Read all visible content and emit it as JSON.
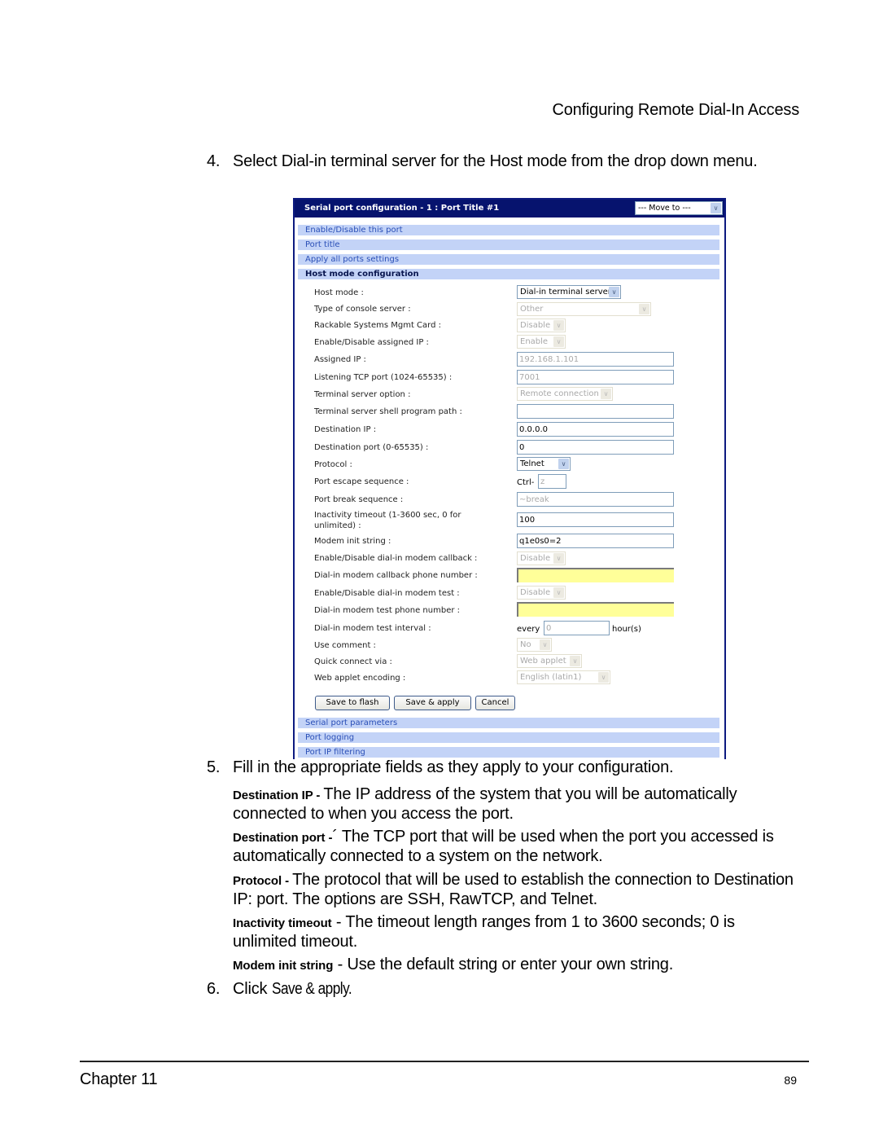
{
  "running_head": "Configuring Remote Dial-In Access",
  "steps": {
    "s4": {
      "num": "4.",
      "text": "Select Dial-in terminal server for the Host mode from the drop down menu."
    },
    "s5": {
      "num": "5.",
      "text": "Fill in the appropriate fields as they apply to your configuration."
    },
    "s6": {
      "num": "6.",
      "prefix": "Click ",
      "command": "Save & apply."
    }
  },
  "descriptions": [
    {
      "term": "Destination IP - ",
      "text": "The IP address of the system that you will be automatically connected to when you access the port."
    },
    {
      "term": "Destination port -",
      "text": "´ The TCP port that will be used when the port you accessed is automatically connected to a system on the network."
    },
    {
      "term": "Protocol - ",
      "text": "The protocol that will be used to establish the connection to Destination IP: port. The options are SSH, RawTCP, and Telnet."
    },
    {
      "term": "Inactivity timeout",
      "text": " - The timeout length ranges from 1 to 3600 seconds; 0 is unlimited timeout."
    },
    {
      "term": "Modem init string",
      "text": " - Use the default string or enter your own string."
    }
  ],
  "screenshot": {
    "title": "Serial port configuration - 1 : Port Title #1",
    "move_to": "--- Move to ---",
    "top_nav": [
      "Enable/Disable this port",
      "Port title",
      "Apply all ports settings",
      "Host mode configuration"
    ],
    "bottom_nav": [
      "Serial port parameters",
      "Port logging",
      "Port IP filtering"
    ],
    "fields": {
      "host_mode": {
        "label": "Host mode :",
        "value": "Dial-in terminal server"
      },
      "console_type": {
        "label": "Type of console server :",
        "value": "Other"
      },
      "rackable": {
        "label": "Rackable Systems Mgmt Card :",
        "value": "Disable"
      },
      "assigned_ip_enable": {
        "label": "Enable/Disable assigned IP :",
        "value": "Enable"
      },
      "assigned_ip": {
        "label": "Assigned IP :",
        "value": "192.168.1.101"
      },
      "listen_port": {
        "label": "Listening TCP port (1024-65535) :",
        "value": "7001"
      },
      "ts_option": {
        "label": "Terminal server option :",
        "value": "Remote connection"
      },
      "shell_path": {
        "label": "Terminal server shell program path :",
        "value": ""
      },
      "dest_ip": {
        "label": "Destination IP :",
        "value": "0.0.0.0"
      },
      "dest_port": {
        "label": "Destination port (0-65535) :",
        "value": "0"
      },
      "protocol": {
        "label": "Protocol :",
        "value": "Telnet"
      },
      "escape_seq": {
        "label": "Port escape sequence :",
        "prefix": "Ctrl-",
        "value": "z"
      },
      "break_seq": {
        "label": "Port break sequence :",
        "value": "~break"
      },
      "inactivity": {
        "label_line1": "Inactivity timeout (1-3600 sec, 0 for",
        "label_line2": "unlimited) :",
        "value": "100"
      },
      "modem_init": {
        "label": "Modem init string :",
        "value": "q1e0s0=2"
      },
      "callback_enable": {
        "label": "Enable/Disable dial-in modem callback :",
        "value": "Disable"
      },
      "callback_phone": {
        "label": "Dial-in modem callback phone number :",
        "value": ""
      },
      "test_enable": {
        "label": "Enable/Disable dial-in modem test :",
        "value": "Disable"
      },
      "test_phone": {
        "label": "Dial-in modem test phone number :",
        "value": ""
      },
      "test_interval": {
        "label": "Dial-in modem test interval :",
        "prefix": "every",
        "value": "0",
        "suffix": "hour(s)"
      },
      "use_comment": {
        "label": "Use comment :",
        "value": "No"
      },
      "quick_connect": {
        "label": "Quick connect via :",
        "value": "Web applet"
      },
      "applet_encoding": {
        "label": "Web applet encoding :",
        "value": "English (latin1)"
      }
    },
    "buttons": {
      "save_flash": "Save to flash",
      "save_apply": "Save & apply",
      "cancel": "Cancel"
    },
    "colors": {
      "header": "#06136e",
      "nav_bar": "#c3d3f7",
      "nav_link": "#2a4fb7",
      "highlight_input": "#ffff99"
    }
  },
  "footer": {
    "chapter": "Chapter 11",
    "page": "89"
  }
}
